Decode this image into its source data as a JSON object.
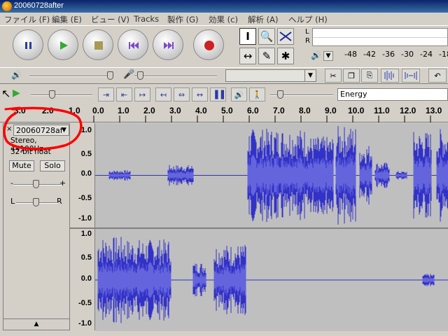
{
  "window": {
    "title": "20060728after"
  },
  "menu": [
    {
      "label": "ファイル (F)"
    },
    {
      "label": "編集 (E)"
    },
    {
      "label": "ビュー (V)"
    },
    {
      "label": "Tracks"
    },
    {
      "label": "製作 (G)"
    },
    {
      "label": "効果 (c)"
    },
    {
      "label": "解析 (A)"
    },
    {
      "label": "ヘルプ (H)"
    }
  ],
  "meter": {
    "channels": [
      "L",
      "R"
    ],
    "scale": [
      "-48",
      "-42",
      "-36",
      "-30",
      "-24",
      "-18"
    ]
  },
  "mixer": {
    "input_source": ""
  },
  "analysis_dropdown": {
    "selected": "Energy"
  },
  "ruler": {
    "labels": [
      "3.0",
      "2.0",
      "1.0",
      "0.0",
      "1.0",
      "2.0",
      "3.0",
      "4.0",
      "5.0",
      "6.0",
      "7.0",
      "8.0",
      "9.0",
      "10.0",
      "11.0",
      "12.0",
      "13.0"
    ]
  },
  "track": {
    "name": "20060728af",
    "format": "Stereo, 44100Hz",
    "sample_format": "32-bit float",
    "mute_label": "Mute",
    "solo_label": "Solo",
    "pan_left": "L",
    "pan_right": "R"
  },
  "vscale": [
    "1.0",
    "0.5",
    "0.0",
    "-0.5",
    "-1.0"
  ],
  "colors": {
    "waveform": "#3232c8",
    "waveform_light": "#6464dc",
    "annotation": "#ff0000"
  }
}
